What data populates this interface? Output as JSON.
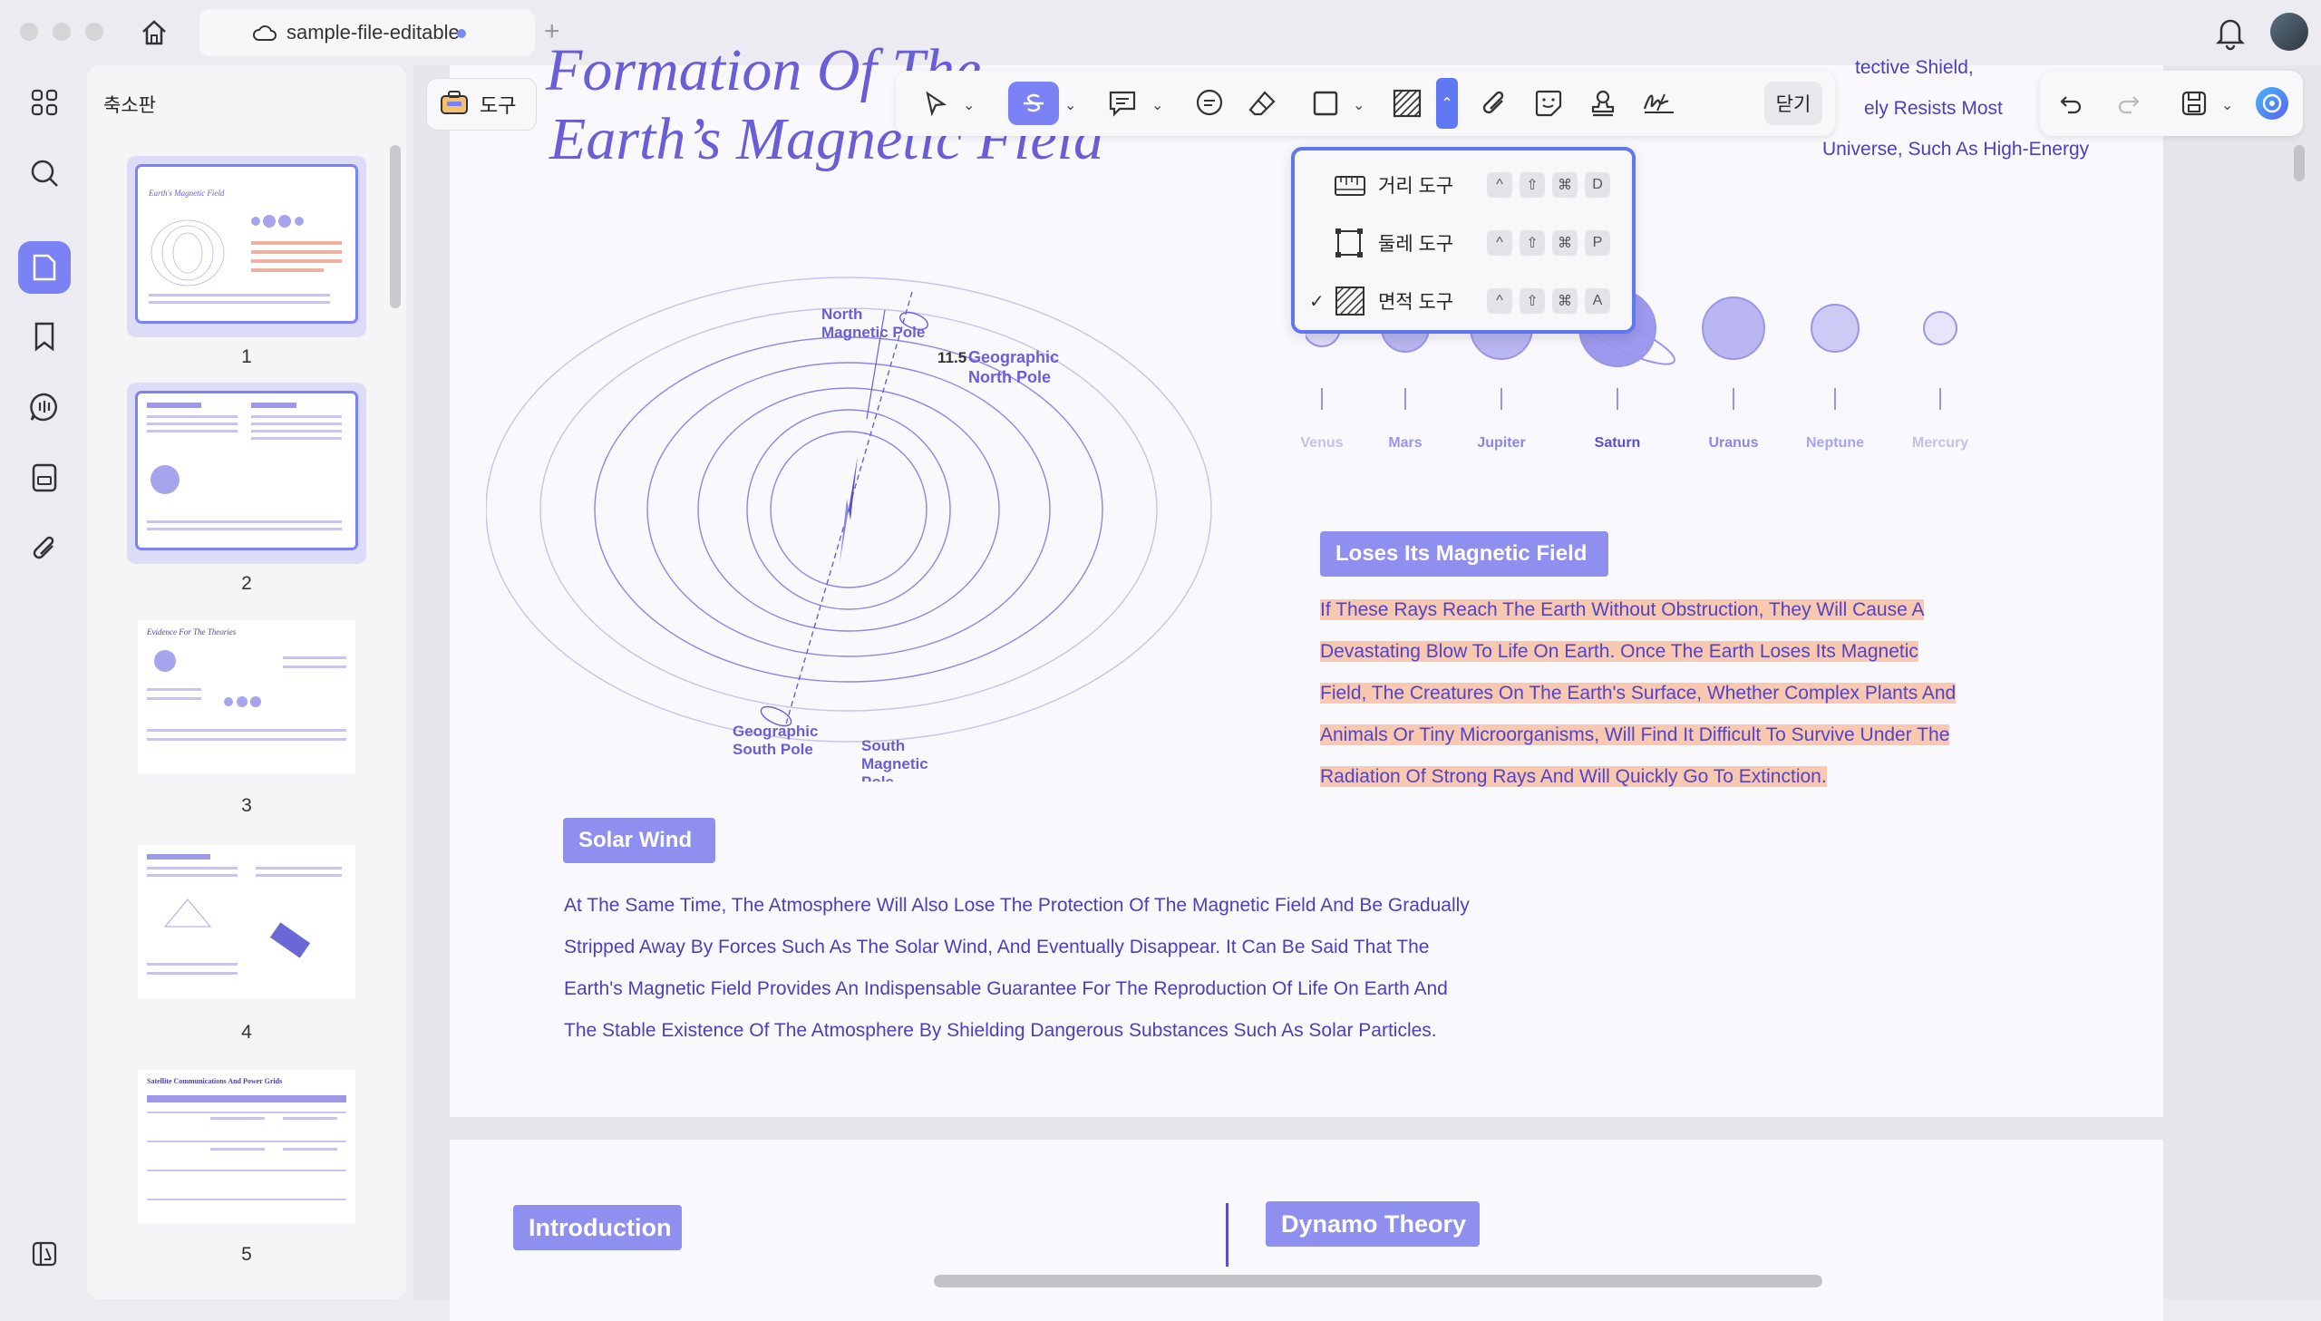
{
  "window": {
    "tab_title": "sample-file-editable"
  },
  "sidebar": {
    "panel_title": "축소판",
    "rail_icons": [
      "grid-icon",
      "search-icon",
      "pages-icon",
      "bookmark-icon",
      "comment-icon",
      "form-icon",
      "attachment-icon",
      "layers-icon"
    ],
    "thumbnails": [
      {
        "page": "1",
        "caption": "Earth's Magnetic Field"
      },
      {
        "page": "2"
      },
      {
        "page": "3",
        "caption": "Evidence For The Theories"
      },
      {
        "page": "4"
      },
      {
        "page": "5",
        "caption": "Satellite Communications And Power Grids"
      }
    ]
  },
  "toolbar": {
    "tools_label": "도구",
    "close_label": "닫기"
  },
  "measure_menu": {
    "items": [
      {
        "label": "거리 도구",
        "keys": [
          "^",
          "⇧",
          "⌘",
          "D"
        ],
        "checked": false
      },
      {
        "label": "둘레 도구",
        "keys": [
          "^",
          "⇧",
          "⌘",
          "P"
        ],
        "checked": false
      },
      {
        "label": "면적 도구",
        "keys": [
          "^",
          "⇧",
          "⌘",
          "A"
        ],
        "checked": true
      }
    ],
    "check_mark": "✓"
  },
  "document": {
    "title_line1": "Formation Of The",
    "title_line2": "Earth’s Magnetic Field",
    "diagram_labels": {
      "north_magnetic": [
        "North",
        "Magnetic Pole"
      ],
      "geo_north": [
        "Geographic",
        "North Pole"
      ],
      "angle": "11.5",
      "geo_south": [
        "Geographic",
        "South Pole"
      ],
      "south_magnetic": [
        "South",
        "Magnetic",
        "Pole"
      ]
    },
    "top_right_text": [
      "tective Shield,",
      "ely Resists Most",
      "Universe, Such As High-Energy"
    ],
    "planets": [
      "Venus",
      "Mars",
      "Jupiter",
      "Saturn",
      "Uranus",
      "Neptune",
      "Mercury"
    ],
    "section1_title": "Loses Its Magnetic Field",
    "section1_lines": [
      "If These Rays Reach The Earth Without Obstruction, They Will Cause A",
      "Devastating Blow To Life On Earth. Once The Earth Loses Its Magnetic",
      "Field, The Creatures On The Earth's Surface, Whether Complex Plants And",
      "Animals Or Tiny Microorganisms, Will Find It Difficult To Survive Under The",
      "Radiation Of Strong Rays And Will Quickly Go To Extinction."
    ],
    "section2_title": "Solar Wind",
    "section2_lines": [
      "At The Same Time, The Atmosphere Will Also Lose The Protection Of The Magnetic Field And Be Gradually",
      "Stripped Away By Forces Such As The Solar Wind, And Eventually Disappear. It Can Be Said That The",
      "Earth's Magnetic Field Provides An Indispensable Guarantee For The Reproduction Of Life On Earth And",
      "The Stable Existence Of The Atmosphere By Shielding Dangerous Substances Such As Solar Particles."
    ],
    "page2_left_title": "Introduction",
    "page2_right_title": "Dynamo Theory"
  },
  "colors": {
    "accent": "#7a82f5",
    "text_purple": "#4b3fbf",
    "highlight": "#f8c8b1",
    "badge": "#8f8ff0"
  }
}
